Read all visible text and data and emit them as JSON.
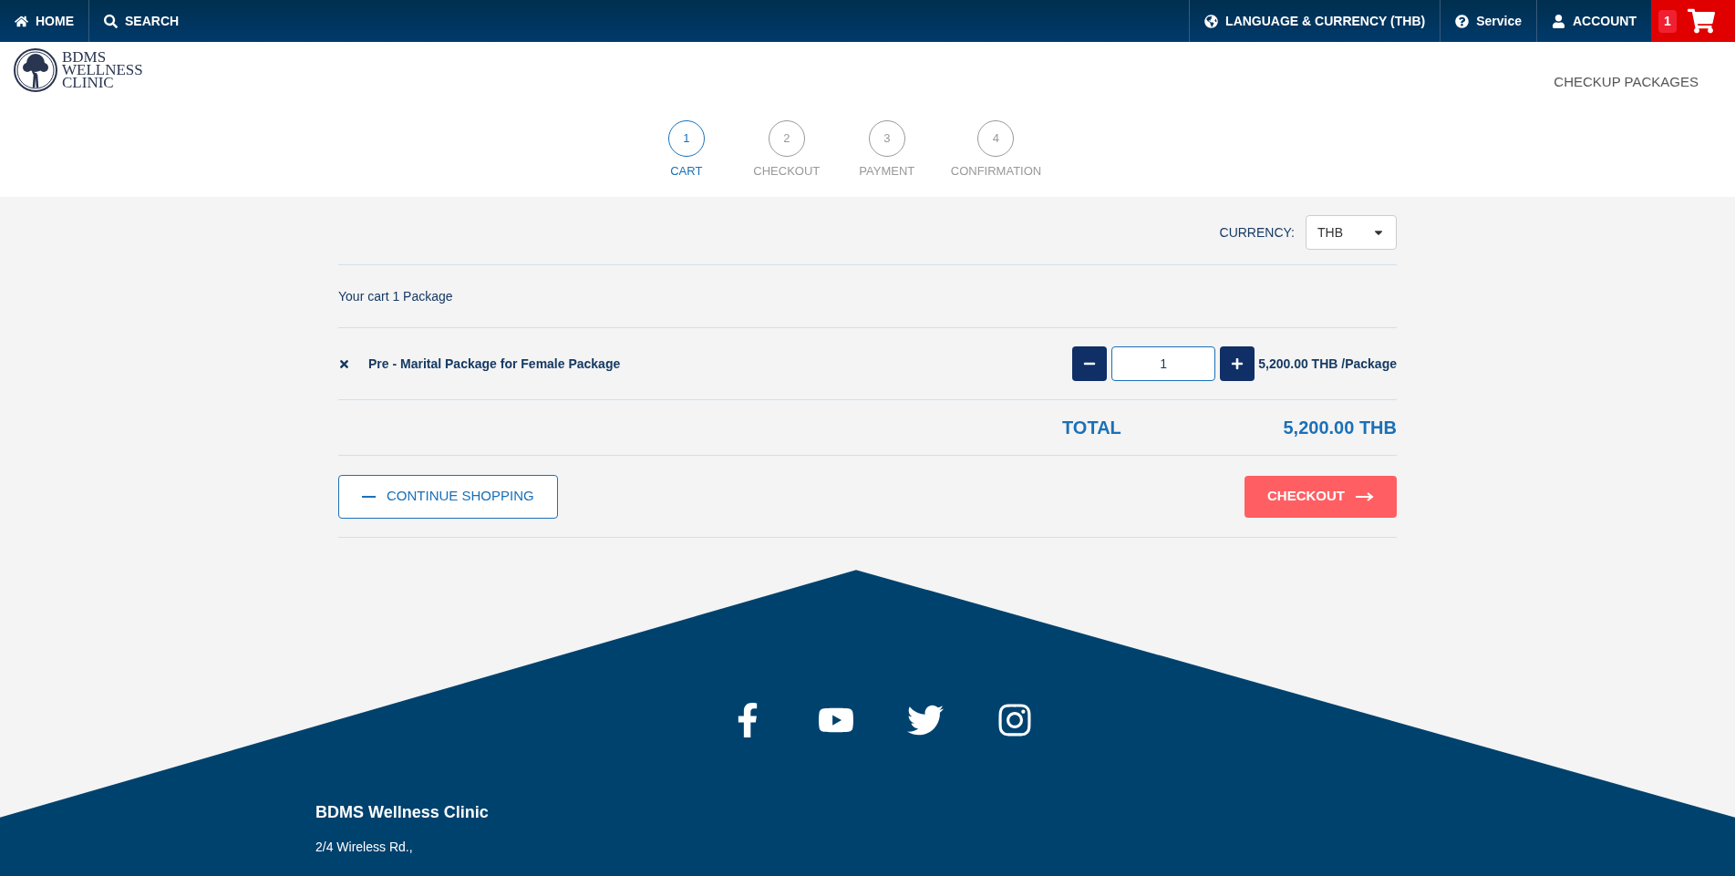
{
  "top_nav": {
    "left": [
      {
        "label": "HOME"
      },
      {
        "label": "SEARCH"
      }
    ],
    "right": [
      {
        "label": "LANGUAGE & CURRENCY (THB)"
      },
      {
        "label": "Service"
      },
      {
        "label": "ACCOUNT"
      }
    ],
    "cart_count": "1"
  },
  "header": {
    "logo_lines": [
      "BDMS",
      "WELLNESS",
      "CLINIC"
    ],
    "nav_link": "CHECKUP PACKAGES"
  },
  "steps": [
    {
      "number": "1",
      "label": "CART",
      "selected": true
    },
    {
      "number": "2",
      "label": "CHECKOUT",
      "selected": false
    },
    {
      "number": "3",
      "label": "PAYMENT",
      "selected": false
    },
    {
      "number": "4",
      "label": "CONFIRMATION",
      "selected": false
    }
  ],
  "currency": {
    "label": "CURRENCY:",
    "value": "THB"
  },
  "cart": {
    "summary": "Your cart 1 Package",
    "items": [
      {
        "name": "Pre - Marital Package for Female Package",
        "quantity": "1",
        "price": "5,200.00 THB /Package"
      }
    ],
    "total_label": "TOTAL",
    "total_value": "5,200.00 THB"
  },
  "buttons": {
    "continue": "CONTINUE SHOPPING",
    "checkout": "CHECKOUT"
  },
  "footer": {
    "title": "BDMS Wellness Clinic",
    "address": "2/4 Wireless Rd.,"
  }
}
